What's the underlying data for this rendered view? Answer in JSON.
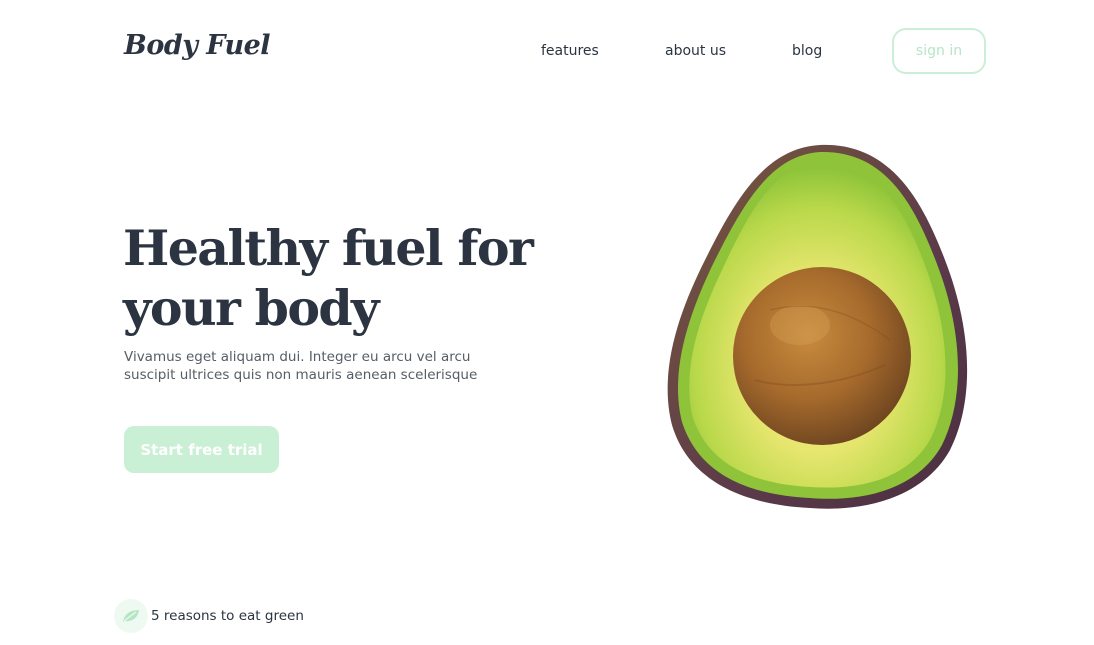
{
  "brand": {
    "name": "Body Fuel"
  },
  "nav": {
    "items": [
      {
        "label": "features"
      },
      {
        "label": "about us"
      },
      {
        "label": "blog"
      }
    ],
    "signin_label": "sign in"
  },
  "hero": {
    "title": "Healthy fuel for your body",
    "subtitle": "Vivamus eget aliquam dui. Integer eu arcu vel arcu suscipit ultrices quis non mauris aenean scelerisque",
    "cta_label": "Start free trial",
    "image_icon": "avocado-icon"
  },
  "footer_link": {
    "icon": "leaf-icon",
    "label": "5 reasons to eat green"
  },
  "colors": {
    "text_dark": "#2b3440",
    "accent_green_light": "#c9efd4",
    "accent_green_border": "#cdeed6",
    "leaf_green": "#b5e6c3"
  }
}
